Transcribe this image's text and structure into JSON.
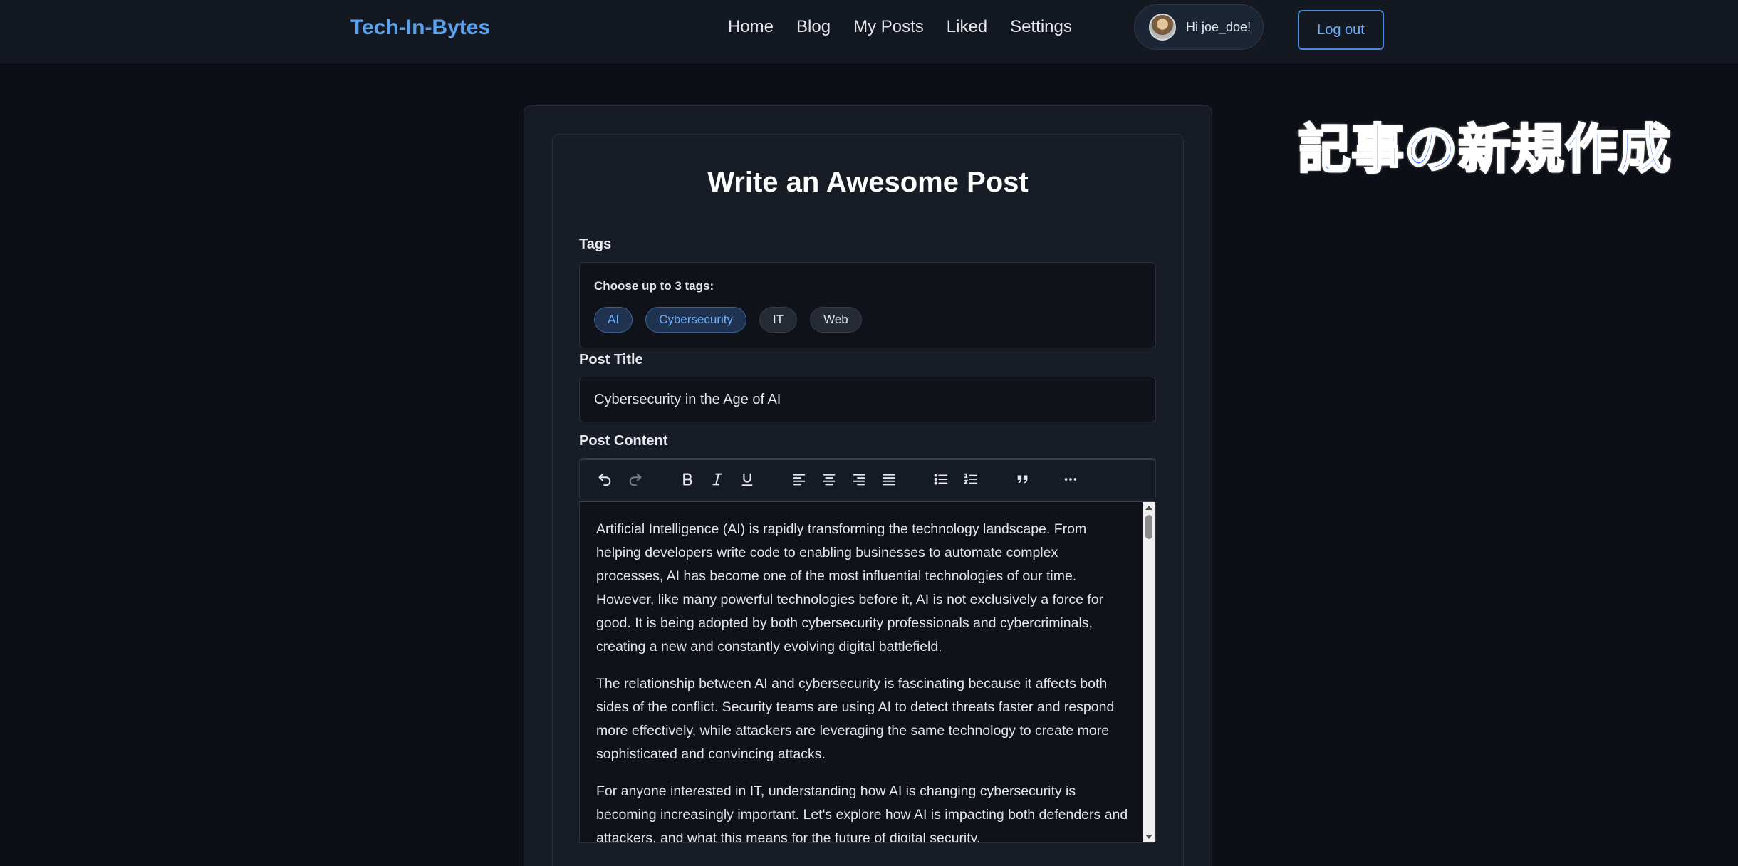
{
  "navbar": {
    "brand": "Tech-In-Bytes",
    "links": [
      "Home",
      "Blog",
      "My Posts",
      "Liked",
      "Settings"
    ],
    "user_greeting": "Hi joe_doe!",
    "logout_label": "Log out"
  },
  "form": {
    "title": "Write an Awesome Post",
    "tags_label": "Tags",
    "tags_hint": "Choose up to 3 tags:",
    "tags": [
      {
        "label": "AI",
        "selected": true
      },
      {
        "label": "Cybersecurity",
        "selected": true
      },
      {
        "label": "IT",
        "selected": false
      },
      {
        "label": "Web",
        "selected": false
      }
    ],
    "post_title_label": "Post Title",
    "post_title_value": "Cybersecurity in the Age of AI",
    "post_content_label": "Post Content",
    "content_paragraphs": [
      "Artificial Intelligence (AI) is rapidly transforming the technology landscape. From helping developers write code to enabling businesses to automate complex processes, AI has become one of the most influential technologies of our time. However, like many powerful technologies before it, AI is not exclusively a force for good. It is being adopted by both cybersecurity professionals and cybercriminals, creating a new and constantly evolving digital battlefield.",
      "The relationship between AI and cybersecurity is fascinating because it affects both sides of the conflict. Security teams are using AI to detect threats faster and respond more effectively, while attackers are leveraging the same technology to create more sophisticated and convincing attacks.",
      "For anyone interested in IT, understanding how AI is changing cybersecurity is becoming increasingly important. Let's explore how AI is impacting both defenders and attackers, and what this means for the future of digital security."
    ]
  },
  "toolbar_icons": [
    "undo-icon",
    "redo-icon",
    "bold-icon",
    "italic-icon",
    "underline-icon",
    "align-left-icon",
    "align-center-icon",
    "align-right-icon",
    "align-justify-icon",
    "bullet-list-icon",
    "numbered-list-icon",
    "quote-icon",
    "more-icon"
  ],
  "overlay": {
    "caption": "記事の新規作成"
  },
  "colors": {
    "accent": "#5aa2ee",
    "selected_tag_text": "#6aaefc",
    "background": "#0c0f16",
    "overlay_text": "#1a63ff"
  }
}
